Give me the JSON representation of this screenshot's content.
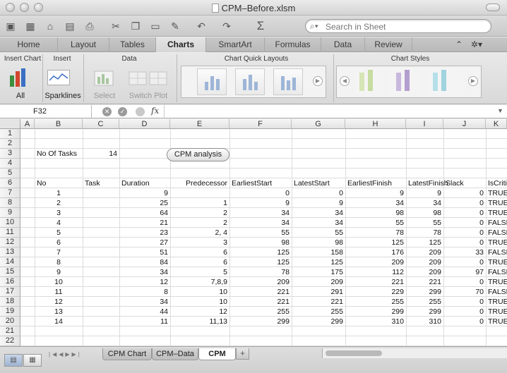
{
  "window": {
    "title": "CPM–Before.xlsm"
  },
  "search": {
    "placeholder": "Search in Sheet"
  },
  "ribbon_tabs": [
    "Home",
    "Layout",
    "Tables",
    "Charts",
    "SmartArt",
    "Formulas",
    "Data",
    "Review"
  ],
  "active_tab": "Charts",
  "ribbon": {
    "insert_chart": "Insert Chart",
    "insert": "Insert",
    "data": "Data",
    "quick_layouts": "Chart Quick Layouts",
    "chart_styles": "Chart Styles",
    "all": "All",
    "sparklines": "Sparklines",
    "select": "Select",
    "switch_plot": "Switch Plot"
  },
  "formula_bar": {
    "name_box": "F32",
    "fx": "fx",
    "formula": ""
  },
  "columns": [
    "A",
    "B",
    "C",
    "D",
    "E",
    "F",
    "G",
    "H",
    "I",
    "J",
    "K"
  ],
  "rows": [
    "1",
    "2",
    "3",
    "4",
    "5",
    "6",
    "7",
    "8",
    "9",
    "10",
    "11",
    "12",
    "13",
    "14",
    "15",
    "16",
    "17",
    "18",
    "19",
    "20",
    "21",
    "22"
  ],
  "sheet": {
    "no_of_tasks_label": "No Of Tasks",
    "no_of_tasks_value": "14",
    "cpm_button": "CPM analysis",
    "headers": [
      "No",
      "Task",
      "Duration",
      "Predecessor",
      "EarliestStart",
      "LatestStart",
      "EarliestFinish",
      "LatestFinish",
      "Slack",
      "IsCritical"
    ],
    "data": [
      [
        "1",
        "",
        "9",
        "",
        "0",
        "0",
        "9",
        "9",
        "0",
        "TRUE"
      ],
      [
        "2",
        "",
        "25",
        "1",
        "9",
        "9",
        "34",
        "34",
        "0",
        "TRUE"
      ],
      [
        "3",
        "",
        "64",
        "2",
        "34",
        "34",
        "98",
        "98",
        "0",
        "TRUE"
      ],
      [
        "4",
        "",
        "21",
        "2",
        "34",
        "34",
        "55",
        "55",
        "0",
        "FALSE"
      ],
      [
        "5",
        "",
        "23",
        "2, 4",
        "55",
        "55",
        "78",
        "78",
        "0",
        "FALSE"
      ],
      [
        "6",
        "",
        "27",
        "3",
        "98",
        "98",
        "125",
        "125",
        "0",
        "TRUE"
      ],
      [
        "7",
        "",
        "51",
        "6",
        "125",
        "158",
        "176",
        "209",
        "33",
        "FALSE"
      ],
      [
        "8",
        "",
        "84",
        "6",
        "125",
        "125",
        "209",
        "209",
        "0",
        "TRUE"
      ],
      [
        "9",
        "",
        "34",
        "5",
        "78",
        "175",
        "112",
        "209",
        "97",
        "FALSE"
      ],
      [
        "10",
        "",
        "12",
        "7,8,9",
        "209",
        "209",
        "221",
        "221",
        "0",
        "TRUE"
      ],
      [
        "11",
        "",
        "8",
        "10",
        "221",
        "291",
        "229",
        "299",
        "70",
        "FALSE"
      ],
      [
        "12",
        "",
        "34",
        "10",
        "221",
        "221",
        "255",
        "255",
        "0",
        "TRUE"
      ],
      [
        "13",
        "",
        "44",
        "12",
        "255",
        "255",
        "299",
        "299",
        "0",
        "TRUE"
      ],
      [
        "14",
        "",
        "11",
        "11,13",
        "299",
        "299",
        "310",
        "310",
        "0",
        "TRUE"
      ]
    ]
  },
  "sheet_tabs": [
    "CPM Chart",
    "CPM–Data",
    "CPM"
  ],
  "active_sheet": "CPM",
  "add_sheet": "+"
}
